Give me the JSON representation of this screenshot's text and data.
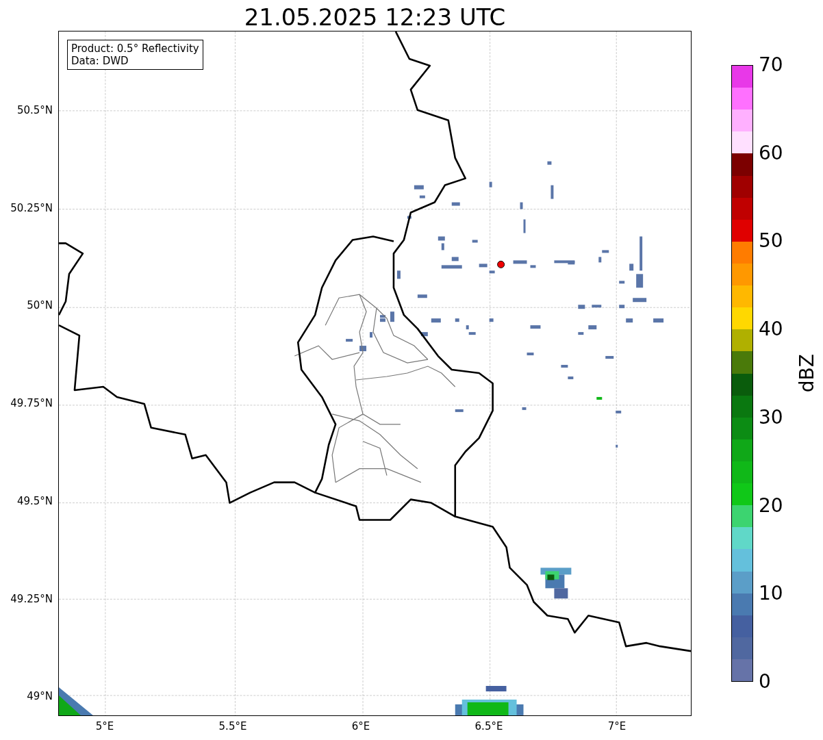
{
  "title": "21.05.2025 12:23 UTC",
  "info_box": [
    "Product: 0.5° Reflectivity",
    "Data: DWD"
  ],
  "y_ticks": [
    "50.5°N",
    "50.25°N",
    "50°N",
    "49.75°N",
    "49.5°N",
    "49.25°N",
    "49°N"
  ],
  "x_ticks": [
    "5°E",
    "5.5°E",
    "6°E",
    "6.5°E",
    "7°E"
  ],
  "colorbar": {
    "label": "dBZ",
    "ticks": [
      "70",
      "60",
      "50",
      "40",
      "30",
      "20",
      "10",
      "0"
    ],
    "segments": [
      {
        "color": "#e838e8"
      },
      {
        "color": "#ff70ff"
      },
      {
        "color": "#ffb0ff"
      },
      {
        "color": "#ffe0ff"
      },
      {
        "color": "#7c0000"
      },
      {
        "color": "#a00000"
      },
      {
        "color": "#c00000"
      },
      {
        "color": "#e00000"
      },
      {
        "color": "#ff7c00"
      },
      {
        "color": "#ff9800"
      },
      {
        "color": "#ffb800"
      },
      {
        "color": "#ffd800"
      },
      {
        "color": "#b0b000"
      },
      {
        "color": "#4a7a0a"
      },
      {
        "color": "#0a5c0c"
      },
      {
        "color": "#0a7810"
      },
      {
        "color": "#0c8c14"
      },
      {
        "color": "#10a818"
      },
      {
        "color": "#10b818"
      },
      {
        "color": "#10c818"
      },
      {
        "color": "#3cd470"
      },
      {
        "color": "#60d8c8"
      },
      {
        "color": "#64c0dc"
      },
      {
        "color": "#5b9ec8"
      },
      {
        "color": "#4a7ab0"
      },
      {
        "color": "#4560a0"
      },
      {
        "color": "#5068a0"
      },
      {
        "color": "#6673a8"
      }
    ]
  }
}
